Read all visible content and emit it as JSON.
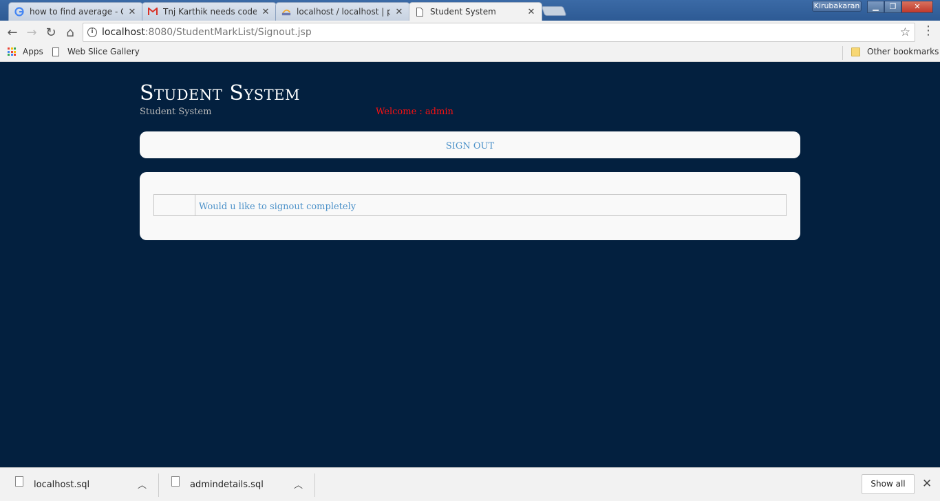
{
  "browser": {
    "tabs": [
      {
        "title": "how to find average - Go",
        "icon": "google-icon"
      },
      {
        "title": "Tnj Karthik needs code -",
        "icon": "gmail-icon"
      },
      {
        "title": "localhost / localhost | ph",
        "icon": "phpmyadmin-icon"
      },
      {
        "title": "Student System",
        "icon": "page-icon"
      }
    ],
    "user": "Kirubakaran",
    "url_host": "localhost",
    "url_path": ":8080/StudentMarkList/Signout.jsp",
    "bookmarks": {
      "apps": "Apps",
      "web_slice": "Web Slice Gallery",
      "other": "Other bookmarks"
    }
  },
  "page": {
    "title": "Student System",
    "subtitle": "Student System",
    "welcome": "Welcome : admin",
    "menu_link": "SIGN OUT",
    "message_link": "Would u like to signout completely"
  },
  "downloads": {
    "files": [
      "localhost.sql",
      "admindetails.sql"
    ],
    "show_all": "Show all"
  }
}
